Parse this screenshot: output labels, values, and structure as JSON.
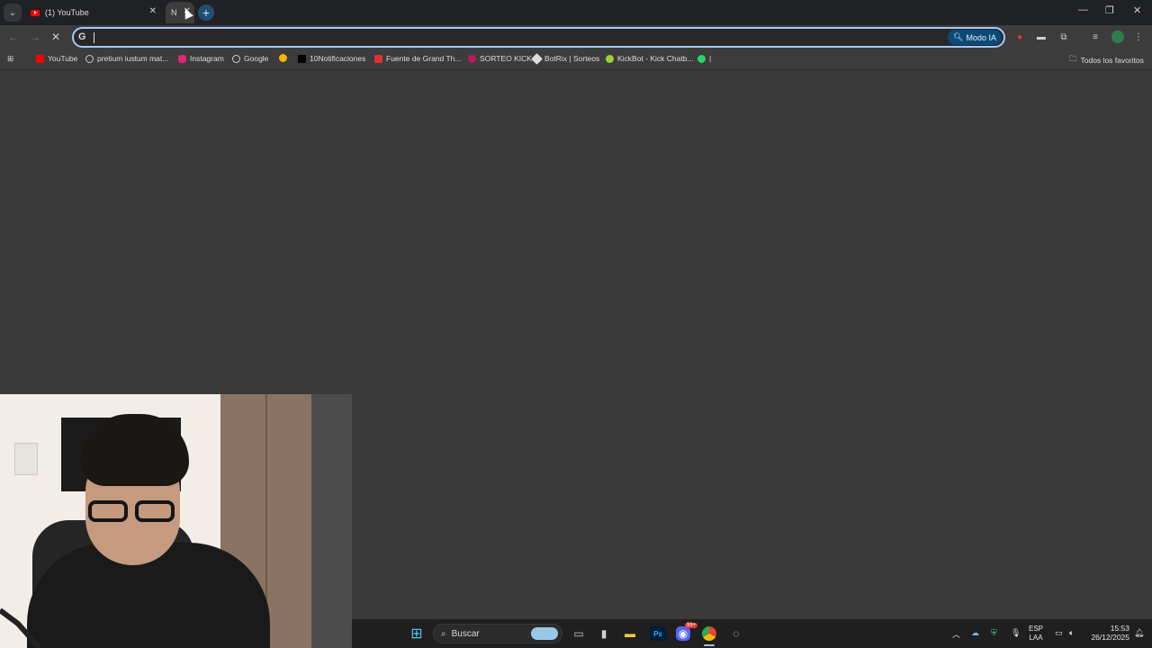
{
  "browser": {
    "tabs": [
      {
        "label": "(1) YouTube",
        "state": "inactive"
      },
      {
        "label": "N",
        "state": "active"
      }
    ],
    "omnibox": {
      "value": "",
      "placeholder": ""
    },
    "ai_mode_label": "Modo IA",
    "all_bookmarks_label": "Todos los favoritos",
    "bookmarks": [
      {
        "label": "YouTube",
        "icon": "youtube-icon"
      },
      {
        "label": "pretium iustum mat...",
        "icon": "google-icon"
      },
      {
        "label": "Instagram",
        "icon": "instagram-icon"
      },
      {
        "label": "Google",
        "icon": "google-icon"
      },
      {
        "label": "",
        "icon": "pinwheel-icon"
      },
      {
        "label": "10Notificaciones",
        "icon": "x-icon"
      },
      {
        "label": "Fuente de Grand Th...",
        "icon": "font-icon"
      },
      {
        "label": "SORTEO KICK",
        "icon": "kick-icon"
      },
      {
        "label": "BotRix | Sorteos",
        "icon": "botrix-icon"
      },
      {
        "label": "KickBot - Kick Chatb...",
        "icon": "kickbot-icon"
      },
      {
        "label": "|",
        "icon": "whatsapp-icon"
      }
    ]
  },
  "taskbar": {
    "search_label": "Buscar",
    "language": {
      "line1": "ESP",
      "line2": "LAA"
    },
    "clock": {
      "time": "15:53",
      "date": "26/12/2025"
    },
    "discord_badge": "99+"
  },
  "colors": {
    "omnibox_border": "#a8c7fa",
    "ai_mode_bg": "#0b4a76",
    "content_bg": "#3a3a3a"
  }
}
